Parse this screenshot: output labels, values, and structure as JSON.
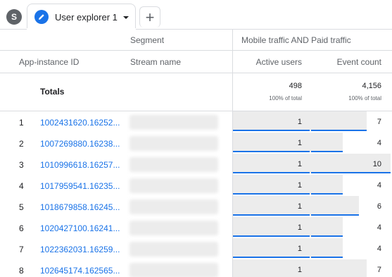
{
  "tabbar": {
    "avatar_letter": "S",
    "tab_label": "User explorer 1",
    "add_tab_label": "+"
  },
  "header": {
    "segment_label": "Segment",
    "segment_value": "Mobile traffic AND Paid traffic",
    "col_id": "App-instance ID",
    "col_stream": "Stream name",
    "col_active": "Active users",
    "col_events": "Event count"
  },
  "totals": {
    "label": "Totals",
    "active_users": "498",
    "active_users_pct": "100% of total",
    "event_count": "4,156",
    "event_count_pct": "100% of total"
  },
  "colors": {
    "accent": "#1a73e8",
    "bar_bg": "#ececec",
    "link": "#1a73e8"
  },
  "rows": [
    {
      "num": "1",
      "id": "1002431620.16252...",
      "active": "1",
      "events": "7",
      "events_ratio": 0.7
    },
    {
      "num": "2",
      "id": "1007269880.16238...",
      "active": "1",
      "events": "4",
      "events_ratio": 0.4
    },
    {
      "num": "3",
      "id": "1010996618.16257...",
      "active": "1",
      "events": "10",
      "events_ratio": 1.0
    },
    {
      "num": "4",
      "id": "1017959541.16235...",
      "active": "1",
      "events": "4",
      "events_ratio": 0.4
    },
    {
      "num": "5",
      "id": "1018679858.16245...",
      "active": "1",
      "events": "6",
      "events_ratio": 0.6
    },
    {
      "num": "6",
      "id": "1020427100.16241...",
      "active": "1",
      "events": "4",
      "events_ratio": 0.4
    },
    {
      "num": "7",
      "id": "1022362031.16259...",
      "active": "1",
      "events": "4",
      "events_ratio": 0.4
    },
    {
      "num": "8",
      "id": "102645174.162565...",
      "active": "1",
      "events": "7",
      "events_ratio": 0.7
    }
  ]
}
